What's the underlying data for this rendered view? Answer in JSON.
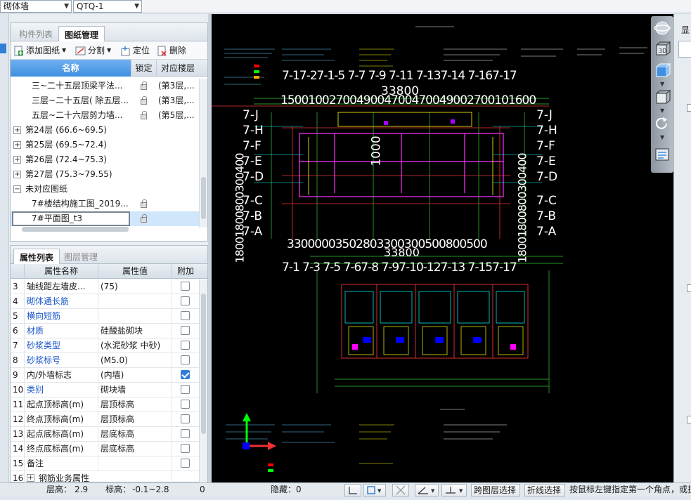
{
  "topbar": {
    "element_type": "砌体墙",
    "element_name": "QTQ-1"
  },
  "upper_panel": {
    "tabs": [
      "构件列表",
      "图纸管理"
    ],
    "active_tab": "图纸管理",
    "toolbar": {
      "add": "添加图纸",
      "split": "分割",
      "locate": "定位",
      "delete": "删除"
    },
    "columns": [
      "名称",
      "锁定",
      "对应楼层"
    ],
    "rows": [
      {
        "name": "三~二十五层顶梁平法...",
        "floor": "(第3层,...",
        "locked": true,
        "child": true
      },
      {
        "name": "三层~二十五层( 除五层...",
        "floor": "(第3层,...",
        "locked": true,
        "child": true
      },
      {
        "name": "五层~二十六层剪力墙...",
        "floor": "(第5层,...",
        "locked": true,
        "child": true
      },
      {
        "name": "第24层 (66.6~69.5)",
        "floor": "",
        "locked": false,
        "group": "+"
      },
      {
        "name": "第25层 (69.5~72.4)",
        "floor": "",
        "locked": false,
        "group": "+"
      },
      {
        "name": "第26层 (72.4~75.3)",
        "floor": "",
        "locked": false,
        "group": "+"
      },
      {
        "name": "第27层 (75.3~79.55)",
        "floor": "",
        "locked": false,
        "group": "+"
      },
      {
        "name": "未对应图纸",
        "floor": "",
        "locked": false,
        "group": "−"
      },
      {
        "name": "7#楼结构施工图_2019...",
        "floor": "",
        "locked": true,
        "child": true
      },
      {
        "name": "7#平面图_t3",
        "floor": "",
        "locked": true,
        "child": true,
        "selected": true
      }
    ]
  },
  "lower_panel": {
    "tabs": [
      "属性列表",
      "图层管理"
    ],
    "active_tab": "属性列表",
    "columns": [
      "属性名称",
      "属性值",
      "附加"
    ],
    "rows": [
      {
        "idx": "3",
        "name": "轴线距左墙皮...",
        "value": "(75)",
        "blue": false,
        "checked": false
      },
      {
        "idx": "4",
        "name": "砌体通长筋",
        "value": "",
        "blue": true,
        "checked": false
      },
      {
        "idx": "5",
        "name": "横向短筋",
        "value": "",
        "blue": true,
        "checked": false
      },
      {
        "idx": "6",
        "name": "材质",
        "value": "硅酸盐砌块",
        "blue": true,
        "checked": false
      },
      {
        "idx": "7",
        "name": "砂浆类型",
        "value": "(水泥砂浆 中砂)",
        "blue": true,
        "checked": false
      },
      {
        "idx": "8",
        "name": "砂浆标号",
        "value": "(M5.0)",
        "blue": true,
        "checked": false
      },
      {
        "idx": "9",
        "name": "内/外墙标志",
        "value": "(内墙)",
        "blue": false,
        "checked": true
      },
      {
        "idx": "10",
        "name": "类别",
        "value": "砌块墙",
        "blue": true,
        "checked": false
      },
      {
        "idx": "11",
        "name": "起点顶标高(m)",
        "value": "层顶标高",
        "blue": false,
        "checked": false
      },
      {
        "idx": "12",
        "name": "终点顶标高(m)",
        "value": "层顶标高",
        "blue": false,
        "checked": false
      },
      {
        "idx": "13",
        "name": "起点底标高(m)",
        "value": "层底标高",
        "blue": false,
        "checked": false
      },
      {
        "idx": "14",
        "name": "终点底标高(m)",
        "value": "层底标高",
        "blue": false,
        "checked": false
      },
      {
        "idx": "15",
        "name": "备注",
        "value": "",
        "blue": false,
        "checked": false
      },
      {
        "idx": "16",
        "name": "钢筋业务属性",
        "value": "",
        "blue": false,
        "checked": false,
        "group": "+"
      }
    ]
  },
  "canvas": {
    "top_axes": "7-17-27-1-5  7-7  7-9  7-11  7-137-14 7-167-17",
    "top_dim_total": "33800",
    "top_dims": "1500100270049004700470049002700101600",
    "left_axes": [
      "7-J",
      "7-H",
      "7-F",
      "7-E",
      "7-D",
      "7-C",
      "7-B",
      "7-A"
    ],
    "right_axes": [
      "7-J",
      "7-H",
      "7-F",
      "7-E",
      "7-D",
      "7-C",
      "7-B",
      "7-A"
    ],
    "mid_dim": "1000",
    "bottom_dims": "33000003502803300300500800500",
    "bottom_dim_total": "33800",
    "bottom_axes": "7-1 7-3  7-5  7-67-8 7-97-10-127-13 7-157-17",
    "vertical_dims_left": "18001800800300400",
    "vertical_dims_right": "18001800800300400"
  },
  "statusbar": {
    "floor_height_label": "层高：",
    "floor_height": "2.9",
    "elevation_label": "标高：",
    "elevation": "-0.1~2.8",
    "count": "0",
    "hidden_label": "隐藏：",
    "hidden": "0",
    "layer_select": "跨图层选择",
    "polyline_select": "折线选择",
    "hint": "按鼠标左键指定第一个角点，或拉"
  },
  "right_panel": {
    "label": "显"
  }
}
